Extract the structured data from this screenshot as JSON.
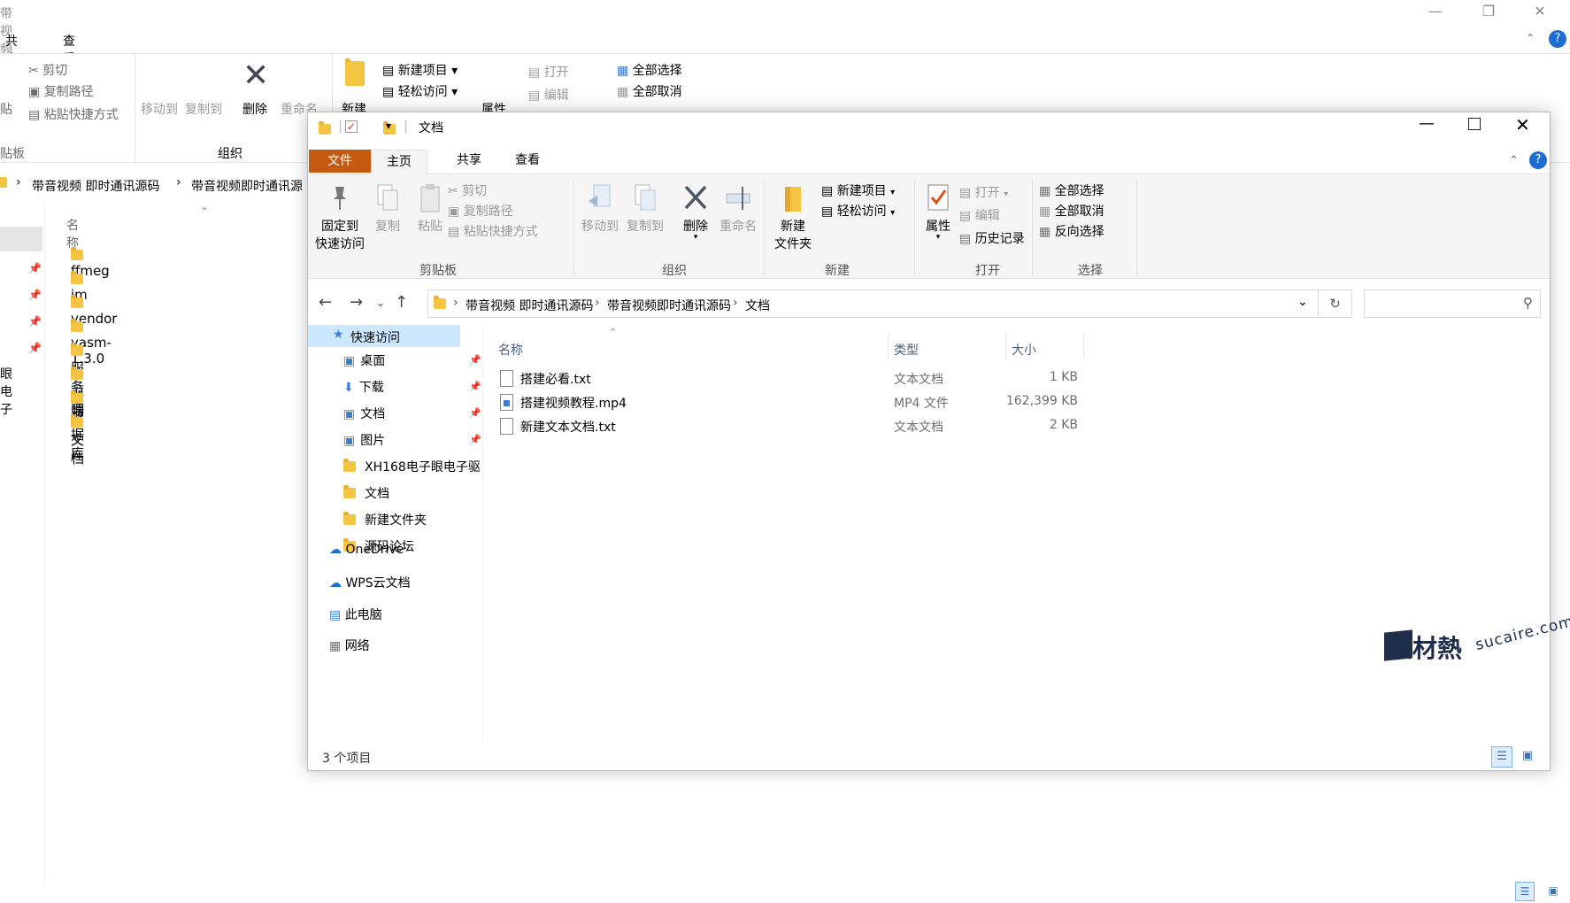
{
  "background_window": {
    "title": "带视频即时通讯源码",
    "tabs": [
      "共享",
      "查看"
    ],
    "ribbon": {
      "cut": "剪切",
      "copy_path": "复制路径",
      "paste_shortcut": "粘贴快捷方式",
      "paste_partial": "贴",
      "move_to": "移动到",
      "copy_to": "复制到",
      "delete": "删除",
      "rename": "重命名",
      "new": "新建",
      "new_item": "新建项目",
      "easy_access": "轻松访问",
      "properties": "属性",
      "open": "打开",
      "edit": "编辑",
      "select_all": "全部选择",
      "select_none": "全部取消",
      "group_clipboard": "贴板",
      "group_organize": "组织"
    },
    "breadcrumb": [
      "带音视频 即时通讯源码",
      "带音视频即时通讯源"
    ],
    "column_name": "名称",
    "sidebar_partial": "眼电子",
    "folders": [
      "ffmeg",
      "im",
      "vendor",
      "yasm-1.3.0",
      "服务端",
      "前端",
      "数据库",
      "文档"
    ]
  },
  "window": {
    "title": "文档",
    "tabs": {
      "file": "文件",
      "home": "主页",
      "share": "共享",
      "view": "查看"
    },
    "ribbon": {
      "pin_quick_access": [
        "固定到",
        "快速访问"
      ],
      "copy": "复制",
      "paste": "粘贴",
      "cut": "剪切",
      "copy_path": "复制路径",
      "paste_shortcut": "粘贴快捷方式",
      "group_clipboard": "剪贴板",
      "move_to": "移动到",
      "copy_to": "复制到",
      "delete": "删除",
      "rename": "重命名",
      "group_organize": "组织",
      "new_folder": [
        "新建",
        "文件夹"
      ],
      "new_item": "新建项目",
      "easy_access": "轻松访问",
      "group_new": "新建",
      "properties": "属性",
      "open": "打开",
      "edit": "编辑",
      "history": "历史记录",
      "group_open": "打开",
      "select_all": "全部选择",
      "select_none": "全部取消",
      "invert_selection": "反向选择",
      "group_select": "选择"
    },
    "breadcrumb": [
      "带音视频 即时通讯源码",
      "带音视频即时通讯源码",
      "文档"
    ],
    "nav": {
      "quick_access": "快速访问",
      "items": [
        {
          "label": "桌面",
          "pinned": true
        },
        {
          "label": "下载",
          "pinned": true
        },
        {
          "label": "文档",
          "pinned": true
        },
        {
          "label": "图片",
          "pinned": true
        },
        {
          "label": "XH168电子眼电子驱",
          "pinned": false
        },
        {
          "label": "文档",
          "pinned": false
        },
        {
          "label": "新建文件夹",
          "pinned": false
        },
        {
          "label": "源码论坛",
          "pinned": false
        }
      ],
      "onedrive": "OneDrive",
      "wps": "WPS云文档",
      "this_pc": "此电脑",
      "network": "网络"
    },
    "columns": {
      "name": "名称",
      "type": "类型",
      "size": "大小"
    },
    "files": [
      {
        "name": "搭建必看.txt",
        "type": "文本文档",
        "size": "1 KB",
        "icon": "text-file-icon"
      },
      {
        "name": "搭建视频教程.mp4",
        "type": "MP4 文件",
        "size": "162,399 KB",
        "icon": "video-file-icon"
      },
      {
        "name": "新建文本文档.txt",
        "type": "文本文档",
        "size": "2 KB",
        "icon": "text-file-icon"
      }
    ],
    "status": "3 个项目",
    "watermark": {
      "brand": "素材熱",
      "site": "sucaire.com"
    }
  },
  "colors": {
    "file_tab": "#c55a11",
    "selection": "#cce8ff",
    "folder": "#f4c542",
    "help": "#1e6ccf"
  }
}
